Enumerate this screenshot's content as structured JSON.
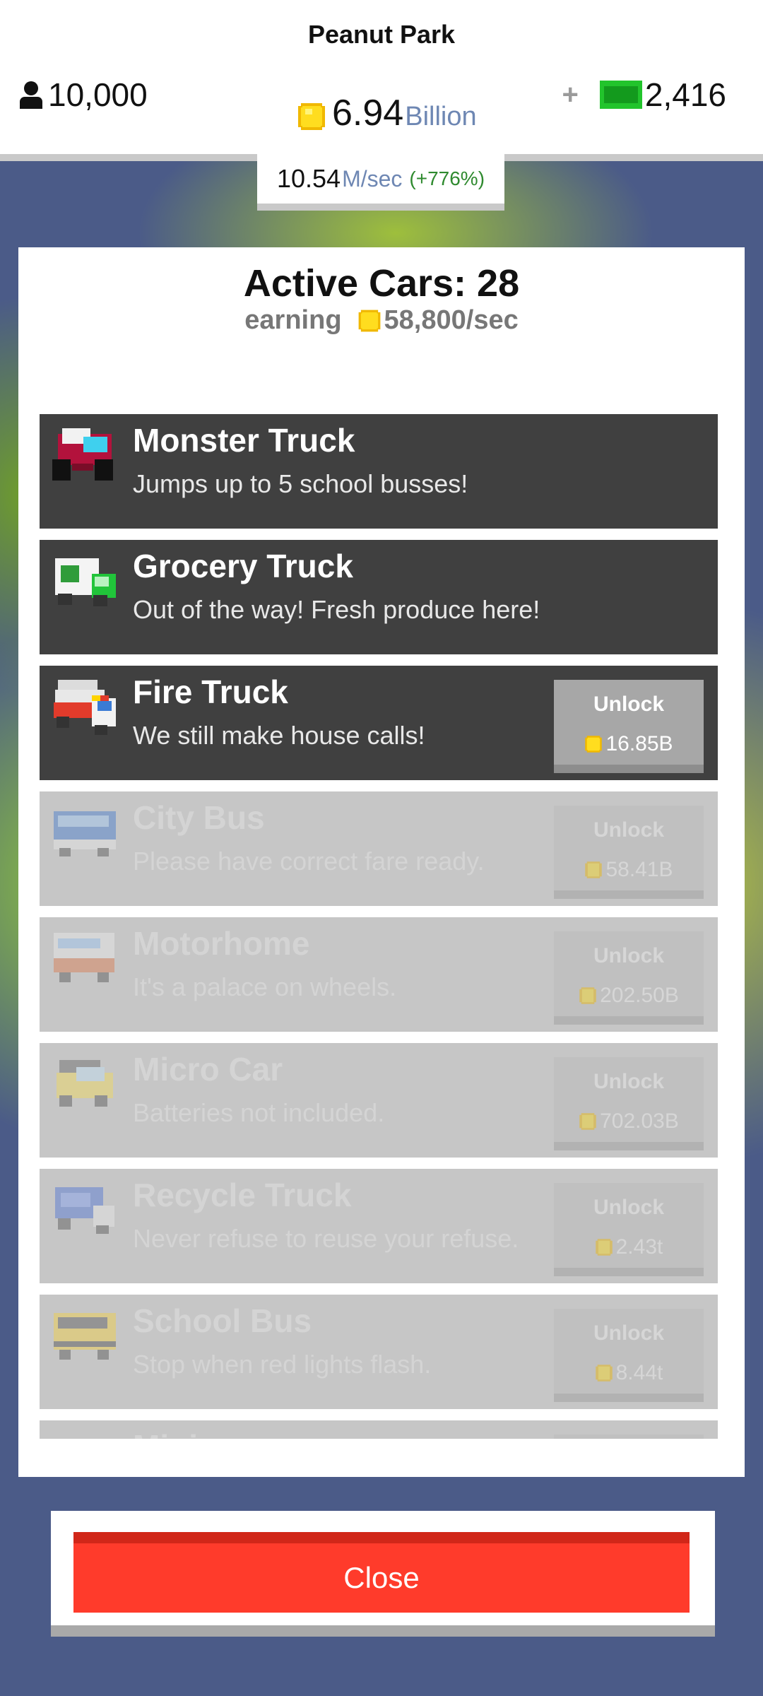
{
  "header": {
    "park_name": "Peanut Park",
    "population": "10,000",
    "coins_amount": "6.94",
    "coins_unit": "Billion",
    "plus": "+",
    "cash": "2,416",
    "rate_value": "10.54",
    "rate_unit": "M/sec",
    "rate_percent": "(+776%)"
  },
  "panel": {
    "title": "Active Cars: 28",
    "earning_label": "earning",
    "earning_value": "58,800/sec"
  },
  "cars": [
    {
      "name": "Monster Truck",
      "desc": "Jumps up to 5 school busses!",
      "icon": "monster-truck-icon"
    },
    {
      "name": "Grocery Truck",
      "desc": "Out of the way! Fresh produce here!",
      "icon": "grocery-truck-icon"
    },
    {
      "name": "Fire Truck",
      "desc": "We still make house calls!",
      "unlock": "Unlock",
      "price": "16.85B",
      "icon": "fire-truck-icon"
    },
    {
      "name": "City Bus",
      "desc": "Please have correct fare ready.",
      "unlock": "Unlock",
      "price": "58.41B",
      "icon": "city-bus-icon"
    },
    {
      "name": "Motorhome",
      "desc": "It's a palace on wheels.",
      "unlock": "Unlock",
      "price": "202.50B",
      "icon": "motorhome-icon"
    },
    {
      "name": "Micro Car",
      "desc": "Batteries not included.",
      "unlock": "Unlock",
      "price": "702.03B",
      "icon": "micro-car-icon"
    },
    {
      "name": "Recycle Truck",
      "desc": "Never refuse to reuse your refuse.",
      "unlock": "Unlock",
      "price": "2.43t",
      "icon": "recycle-truck-icon"
    },
    {
      "name": "School Bus",
      "desc": "Stop when red lights flash.",
      "unlock": "Unlock",
      "price": "8.44t",
      "icon": "school-bus-icon"
    },
    {
      "name": "Minivan",
      "icon": "minivan-icon"
    }
  ],
  "close_label": "Close",
  "colors": {
    "accent_red": "#ff3b2b",
    "owned_row": "#404040",
    "locked_row": "#c6c6c6",
    "coin_gold": "#ffd400",
    "cash_green": "#1fb42a"
  }
}
